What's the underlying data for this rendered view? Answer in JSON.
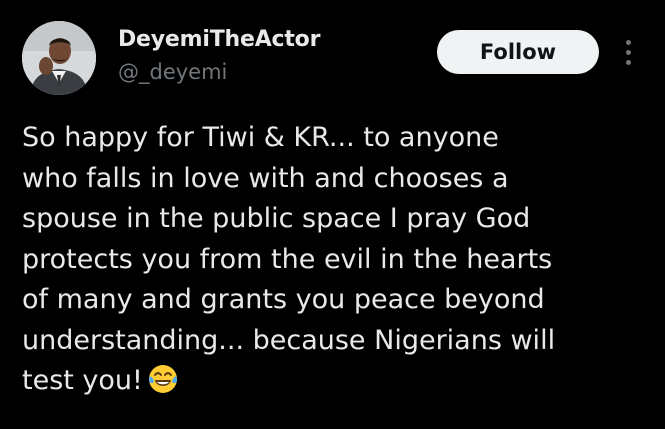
{
  "author": {
    "display_name": "DeyemiTheActor",
    "handle": "@_deyemi",
    "avatar_icon": "profile-photo"
  },
  "actions": {
    "follow_label": "Follow",
    "more_icon": "more-vertical-icon"
  },
  "tweet": {
    "lines": [
      "So happy for Tiwi & KR... to anyone",
      "who falls in love with and chooses a",
      "spouse in the public space I pray God",
      "protects you from the evil in the hearts",
      "of many and grants you peace beyond",
      "understanding... because Nigerians will",
      "test you!"
    ],
    "emoji": "face-with-tears-of-joy"
  },
  "colors": {
    "background": "#000000",
    "text_primary": "#e7e9ea",
    "text_secondary": "#71767b",
    "follow_button_bg": "#eff3f4",
    "follow_button_text": "#0f1419"
  }
}
